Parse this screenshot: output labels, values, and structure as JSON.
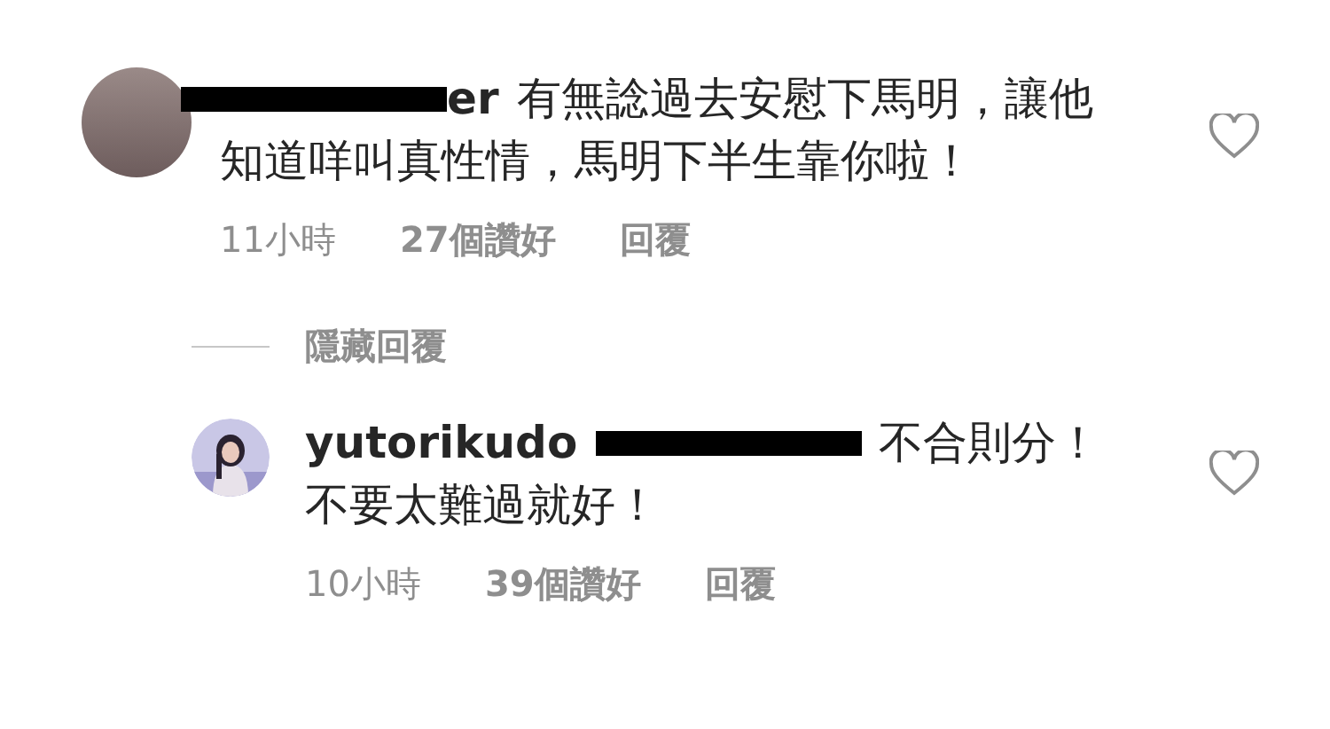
{
  "comments": [
    {
      "username": "er",
      "username_redacted": true,
      "mention_redacted": false,
      "text_lines": [
        "有無諗過去安慰下馬明，讓他",
        "知道咩叫真性情，馬明下半生靠你啦！"
      ],
      "time": "11小時",
      "likes": "27個讚好",
      "reply": "回覆",
      "liked": false,
      "avatar": {
        "kind": "plain"
      }
    },
    {
      "username": "yutorikudo",
      "username_redacted": false,
      "mention_redacted": true,
      "text_lines": [
        "不合則分！",
        "不要太難過就好！"
      ],
      "time": "10小時",
      "likes": "39個讚好",
      "reply": "回覆",
      "liked": false
    }
  ],
  "hide_replies": "隱藏回覆"
}
